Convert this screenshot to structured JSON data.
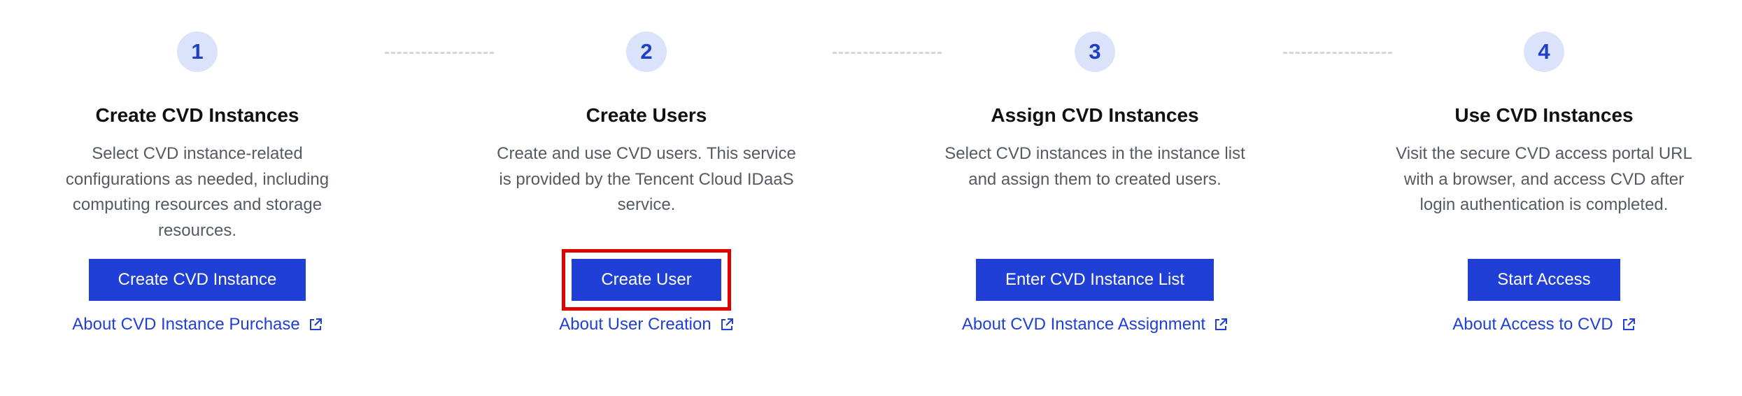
{
  "steps": [
    {
      "number": "1",
      "title": "Create CVD Instances",
      "description": "Select CVD instance-related configurations as needed, including computing resources and storage resources.",
      "button_label": "Create CVD Instance",
      "link_label": "About CVD Instance Purchase",
      "link_icon": "external-link-icon"
    },
    {
      "number": "2",
      "title": "Create Users",
      "description": "Create and use CVD users. This service is provided by the Tencent Cloud IDaaS service.",
      "button_label": "Create User",
      "link_label": "About User Creation",
      "link_icon": "external-link-icon",
      "highlight_color": "#e00000"
    },
    {
      "number": "3",
      "title": "Assign CVD Instances",
      "description": "Select CVD instances in the instance list and assign them to created users.",
      "button_label": "Enter CVD Instance List",
      "link_label": "About CVD Instance Assignment",
      "link_icon": "external-link-icon"
    },
    {
      "number": "4",
      "title": "Use CVD Instances",
      "description": "Visit the secure CVD access portal URL with a browser, and access CVD after login authentication is completed.",
      "button_label": "Start Access",
      "link_label": "About Access to CVD",
      "link_icon": "external-link-icon"
    }
  ],
  "colors": {
    "accent": "#1f3fd6",
    "badge_background": "#dbe3fb",
    "highlight": "#e00000",
    "connector": "#d4d7dc"
  }
}
